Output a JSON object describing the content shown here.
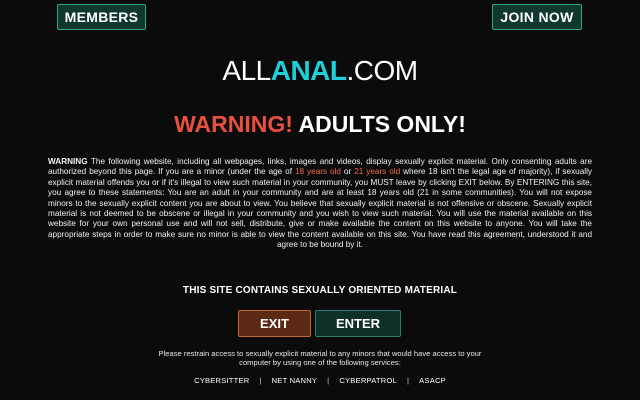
{
  "header": {
    "members_label": "MEMBERS",
    "join_label": "JOIN NOW"
  },
  "logo": {
    "part1": "ALL",
    "part2": "ANAL",
    "part3": ".COM"
  },
  "warning": {
    "part1": "WARNING!",
    "part2": "ADULTS ONLY!"
  },
  "disclaimer": {
    "lead": "WARNING",
    "t1": " The following website, including all webpages, links, images and videos, display sexually explicit material. Only consenting adults are authorized beyond this page. If you are a minor (under the age of ",
    "age1": "18 years old",
    "t2": " or ",
    "age2": "21 years old",
    "t3": " where 18 isn't the legal age of majority), if sexually explicit material offends you or if it's illegal to view such material in your community, you MUST leave by clicking EXIT below. By ENTERING this site, you agree to these statements: You are an adult in your community and are at least 18 years old (21 in some communities). You will not expose minors to the sexually explicit content you are about to view. You believe that sexually explicit material is not offensive or obscene. Sexually explicit material is not deemed to be obscene or illegal in your community and you wish to view such material. You will use the material available on this website for your own personal use and will not sell, distribute, give or make available the content on this website to anyone. You will take the appropriate steps in order to make sure no minor is able to view the content available on this site. You have read this agreement, understood it and agree to be bound by it."
  },
  "notice": "THIS SITE CONTAINS SEXUALLY ORIENTED MATERIAL",
  "actions": {
    "exit_label": "EXIT",
    "enter_label": "ENTER"
  },
  "restrain_text": "Please restrain access to sexually explicit material to any minors that would have access to your computer by using one of the following services:",
  "filters": [
    "CYBERSITTER",
    "NET NANNY",
    "CYBERPATROL",
    "ASACP"
  ],
  "colors": {
    "accent_teal": "#1fd0d8",
    "warning_red": "#e8513f",
    "age_highlight": "#f26b4a",
    "exit_bg": "#5c2a14",
    "enter_bg": "#0f2f2a"
  }
}
